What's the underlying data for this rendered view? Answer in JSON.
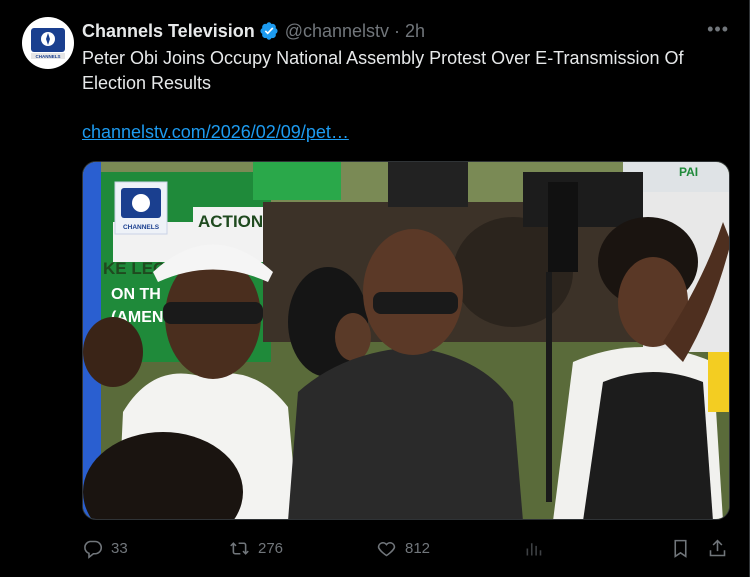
{
  "author": {
    "display_name": "Channels Television",
    "handle": "@channelstv",
    "separator": "·",
    "time": "2h",
    "avatar_icon": "channels-tv-logo",
    "verified_color": "#1d9bf0"
  },
  "tweet": {
    "text": "Peter Obi Joins Occupy National Assembly Protest Over E-Transmission Of Election Results",
    "link": "channelstv.com/2026/02/09/pet…",
    "more_label": "•••"
  },
  "media": {
    "watermark": "CHANNELS",
    "sign_text_1": "ACTION",
    "sign_text_2": "KE LEGI",
    "sign_text_3": "ON TH",
    "sign_text_4": "(AMEN",
    "sign_text_5": "PAI"
  },
  "actions": {
    "replies": "33",
    "reposts": "276",
    "likes": "812"
  },
  "colors": {
    "background": "#000000",
    "text": "#e7e9ea",
    "secondary": "#71767b",
    "link": "#1d9bf0"
  }
}
